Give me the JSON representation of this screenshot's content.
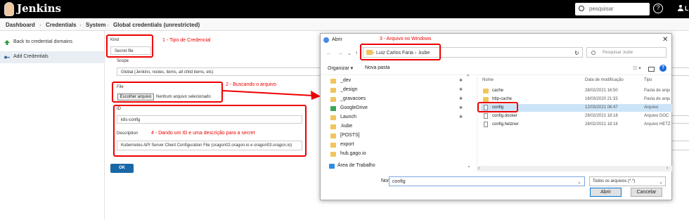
{
  "header": {
    "brand": "Jenkins",
    "search_placeholder": "pesquisar",
    "user_initial": "L"
  },
  "breadcrumb": [
    "Dashboard",
    "Credentials",
    "System",
    "Global credentials (unrestricted)"
  ],
  "sidebar": {
    "items": [
      {
        "label": "Back to credential domains",
        "icon": "up-arrow-icon"
      },
      {
        "label": "Add Credentials",
        "icon": "key-icon"
      }
    ]
  },
  "form": {
    "kind_label": "Kind",
    "kind_value": "Secret file",
    "scope_label": "Scope",
    "scope_value": "Global (Jenkins, nodes, items, all child items, etc)",
    "file_label": "File",
    "file_button": "Escolher arquivo",
    "file_status": "Nenhum arquivo selecionado",
    "id_label": "ID",
    "id_value": "k8s-config",
    "description_label": "Description",
    "description_value": "Kubernetes API Server Client Configuration File (oragon02.oragon.io e oragon03.oragon.io)",
    "ok_label": "OK"
  },
  "annotations": {
    "a1": "1 - Tipo de Credencial",
    "a2": "2 - Buscando o arquivo",
    "a3": "3 - Arquivo no Windows",
    "a4": "4 - Dando um ID e uma descrição para a secret"
  },
  "dialog": {
    "title": "Abrir",
    "path": [
      "Luiz Carlos Faria",
      ".kube"
    ],
    "search_placeholder": "Pesquisar .kube",
    "organize": "Organizar ▾",
    "new_folder": "Nova pasta",
    "tree": [
      {
        "label": "_dev",
        "pinned": true
      },
      {
        "label": "_design",
        "pinned": true
      },
      {
        "label": "_gravacoes",
        "pinned": true
      },
      {
        "label": "GoogleDrive",
        "pinned": true
      },
      {
        "label": "Launch",
        "pinned": true
      },
      {
        "label": ".kube",
        "pinned": false
      },
      {
        "label": "[POSTS]",
        "pinned": false
      },
      {
        "label": "export",
        "pinned": false
      },
      {
        "label": "hub.gago.io",
        "pinned": false
      },
      {
        "label": "Área de Trabalho",
        "pinned": false
      }
    ],
    "columns": {
      "name": "Nome",
      "date": "Data de modificação",
      "type": "Tipo"
    },
    "files": [
      {
        "name": "cache",
        "date": "28/02/2021 16:50",
        "type": "Pasta de arqu",
        "kind": "folder"
      },
      {
        "name": "http-cache",
        "date": "16/03/2020 21:33",
        "type": "Pasta de arqu",
        "kind": "folder"
      },
      {
        "name": "config",
        "date": "12/03/2021 06:47",
        "type": "Arquivo",
        "kind": "file",
        "selected": true
      },
      {
        "name": "config.docker",
        "date": "28/02/2021 18:18",
        "type": "Arquivo DOC",
        "kind": "file"
      },
      {
        "name": "config.hetzner",
        "date": "28/02/2021 18:18",
        "type": "Arquivo HETZ",
        "kind": "file"
      }
    ],
    "filename_label": "Nome:",
    "filename_value": "config",
    "filter": "Todos os arquivos (*.*)",
    "open_label": "Abrir",
    "cancel_label": "Cancelar"
  },
  "colors": {
    "accent_red": "#e00000",
    "ok_blue": "#1868a8",
    "selection": "#cce4f7",
    "folder": "#f2c55c"
  }
}
